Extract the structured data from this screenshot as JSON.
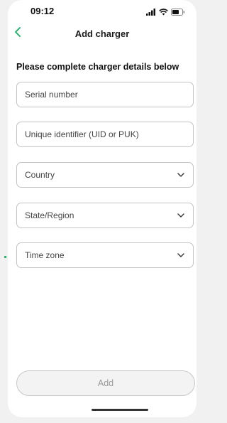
{
  "status_bar": {
    "time": "09:12",
    "icons": [
      "signal-icon",
      "wifi-icon",
      "battery-icon"
    ]
  },
  "nav": {
    "back_icon": "chevron-left-icon",
    "title": "Add charger"
  },
  "form": {
    "heading": "Please complete charger details below",
    "serial_number": {
      "placeholder": "Serial number",
      "value": ""
    },
    "unique_identifier": {
      "placeholder": "Unique identifier (UID or PUK)",
      "value": ""
    },
    "country": {
      "label": "Country"
    },
    "state_region": {
      "label": "State/Region"
    },
    "time_zone": {
      "label": "Time zone"
    }
  },
  "actions": {
    "add_label": "Add"
  },
  "colors": {
    "accent": "#2bb673",
    "border": "#c4c4c4",
    "disabled_text": "#9a9a9a",
    "background": "#ffffff"
  }
}
